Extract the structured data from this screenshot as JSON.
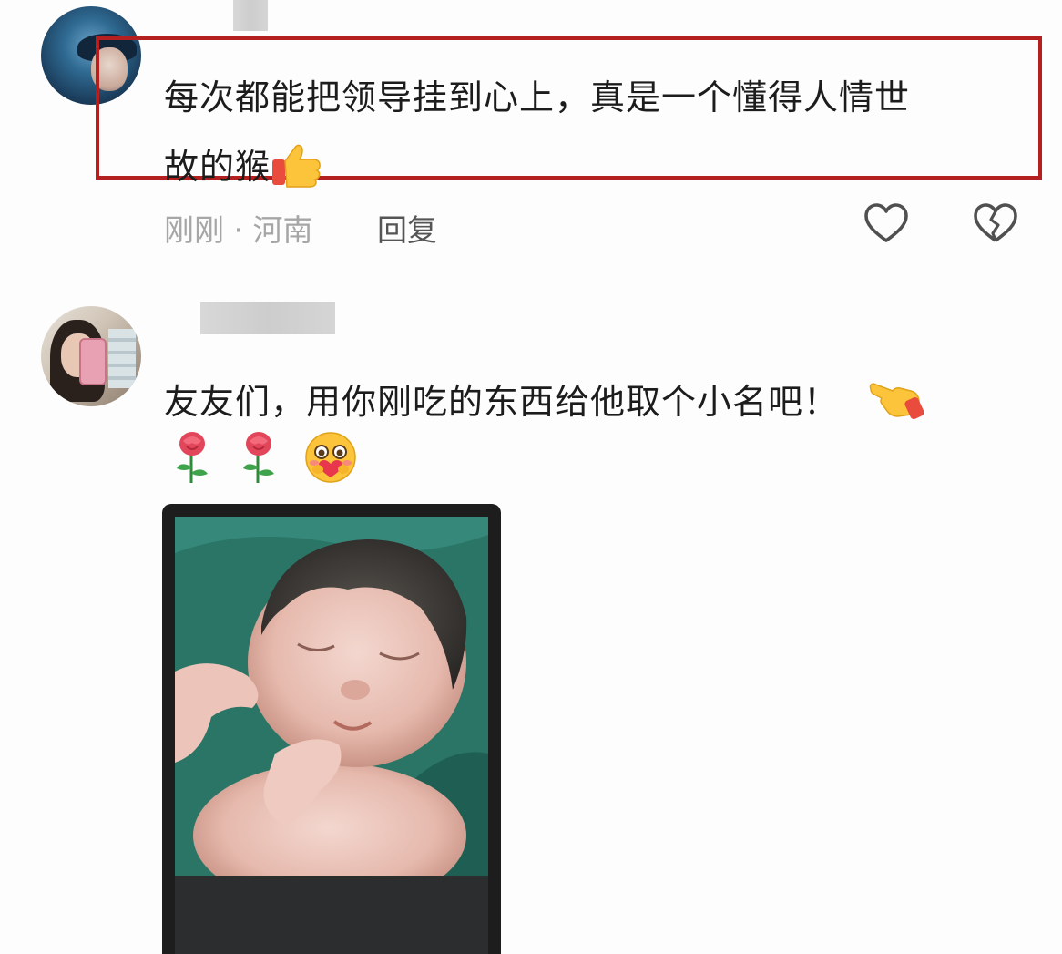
{
  "comments": [
    {
      "text_line1": "每次都能把领导挂到心上，真是一个懂得人情世",
      "text_line2": "故的猴",
      "thumbs_emoji": "👍",
      "time": "刚刚",
      "location": "河南",
      "meta": "刚刚 · 河南",
      "reply_label": "回复",
      "like_icon": "heart-outline-icon",
      "dislike_icon": "broken-heart-outline-icon",
      "highlight_color": "#b3201f"
    },
    {
      "text_line1": "友友们，用你刚吃的东西给他取个小名吧！",
      "pointing_emoji": "👈",
      "emoji_line": [
        "🌹",
        "🌹",
        "🥰"
      ],
      "attached_image": "newborn-baby-photo"
    }
  ],
  "colors": {
    "text": "#1c1c1c",
    "meta": "#a6a6a6",
    "reply": "#555555"
  }
}
